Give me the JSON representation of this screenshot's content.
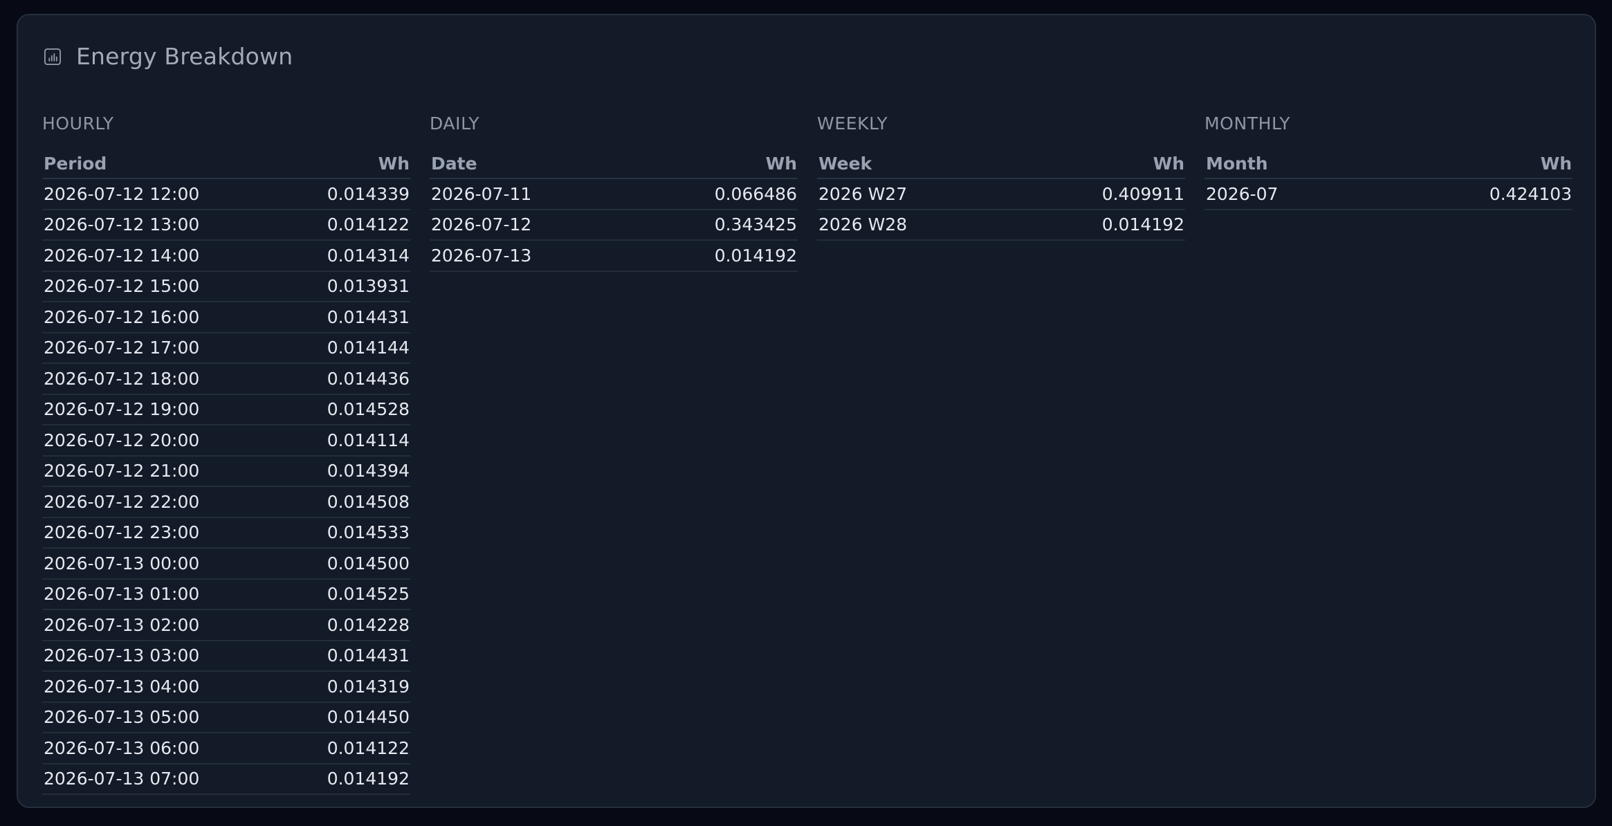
{
  "card": {
    "title": "Energy Breakdown",
    "icon": "bar-chart-icon"
  },
  "colors": {
    "background": "#070a14",
    "card": "#131a28",
    "border": "#262f40",
    "text": "#e6e9ef",
    "muted": "#9aa2b1"
  },
  "sections": [
    {
      "title": "HOURLY",
      "columns": [
        "Period",
        "Wh"
      ],
      "rows": [
        [
          "2026-07-12 12:00",
          "0.014339"
        ],
        [
          "2026-07-12 13:00",
          "0.014122"
        ],
        [
          "2026-07-12 14:00",
          "0.014314"
        ],
        [
          "2026-07-12 15:00",
          "0.013931"
        ],
        [
          "2026-07-12 16:00",
          "0.014431"
        ],
        [
          "2026-07-12 17:00",
          "0.014144"
        ],
        [
          "2026-07-12 18:00",
          "0.014436"
        ],
        [
          "2026-07-12 19:00",
          "0.014528"
        ],
        [
          "2026-07-12 20:00",
          "0.014114"
        ],
        [
          "2026-07-12 21:00",
          "0.014394"
        ],
        [
          "2026-07-12 22:00",
          "0.014508"
        ],
        [
          "2026-07-12 23:00",
          "0.014533"
        ],
        [
          "2026-07-13 00:00",
          "0.014500"
        ],
        [
          "2026-07-13 01:00",
          "0.014525"
        ],
        [
          "2026-07-13 02:00",
          "0.014228"
        ],
        [
          "2026-07-13 03:00",
          "0.014431"
        ],
        [
          "2026-07-13 04:00",
          "0.014319"
        ],
        [
          "2026-07-13 05:00",
          "0.014450"
        ],
        [
          "2026-07-13 06:00",
          "0.014122"
        ],
        [
          "2026-07-13 07:00",
          "0.014192"
        ]
      ]
    },
    {
      "title": "DAILY",
      "columns": [
        "Date",
        "Wh"
      ],
      "rows": [
        [
          "2026-07-11",
          "0.066486"
        ],
        [
          "2026-07-12",
          "0.343425"
        ],
        [
          "2026-07-13",
          "0.014192"
        ]
      ]
    },
    {
      "title": "WEEKLY",
      "columns": [
        "Week",
        "Wh"
      ],
      "rows": [
        [
          "2026 W27",
          "0.409911"
        ],
        [
          "2026 W28",
          "0.014192"
        ]
      ]
    },
    {
      "title": "MONTHLY",
      "columns": [
        "Month",
        "Wh"
      ],
      "rows": [
        [
          "2026-07",
          "0.424103"
        ]
      ]
    }
  ]
}
